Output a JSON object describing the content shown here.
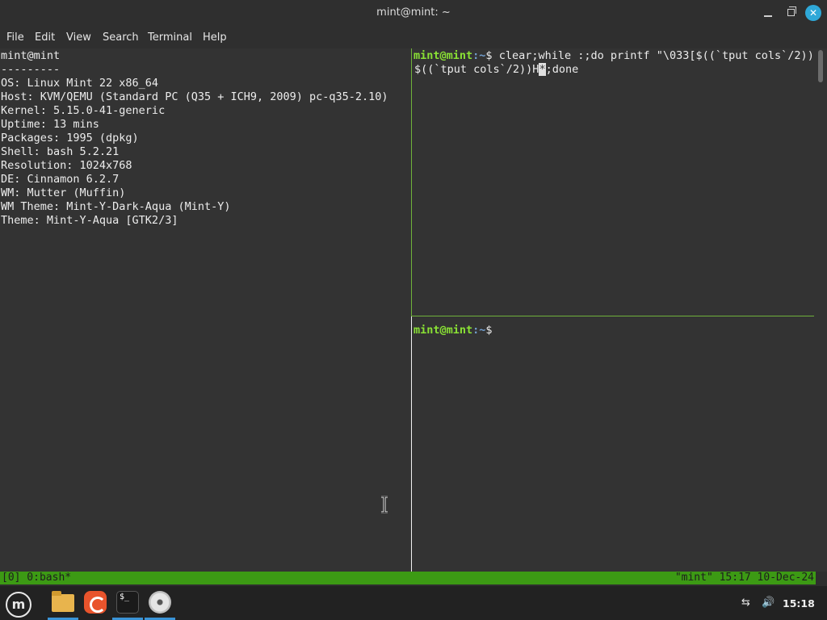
{
  "window": {
    "title": "mint@mint: ~",
    "minimize_icon": "minimize-icon",
    "maximize_icon": "maximize-icon",
    "close_icon": "close-icon",
    "close_glyph": "✕"
  },
  "menu": {
    "items": [
      "File",
      "Edit",
      "View",
      "Search",
      "Terminal",
      "Help"
    ]
  },
  "left_pane": {
    "lines": [
      "mint@mint",
      "---------",
      "OS: Linux Mint 22 x86_64",
      "Host: KVM/QEMU (Standard PC (Q35 + ICH9, 2009) pc-q35-2.10)",
      "Kernel: 5.15.0-41-generic",
      "Uptime: 13 mins",
      "Packages: 1995 (dpkg)",
      "Shell: bash 5.2.21",
      "Resolution: 1024x768",
      "DE: Cinnamon 6.2.7",
      "WM: Mutter (Muffin)",
      "WM Theme: Mint-Y-Dark-Aqua (Mint-Y)",
      "Theme: Mint-Y-Aqua [GTK2/3]"
    ]
  },
  "right_top_pane": {
    "prompt_user": "mint@mint",
    "prompt_path": ":~",
    "prompt_sign": "$ ",
    "command_line1": "clear;while :;do printf \"\\033[$((`tput cols`/2));",
    "command_line2_pre": "$((`tput cols`/2))H",
    "command_line2_cursor": "*",
    "command_line2_post": ";done"
  },
  "right_bottom_pane": {
    "prompt_user": "mint@mint",
    "prompt_path": ":~",
    "prompt_sign": "$"
  },
  "tmux_status": {
    "left": "[0] 0:bash*",
    "right": "\"mint\" 15:17 10-Dec-24"
  },
  "taskbar": {
    "menu_logo_text": "m",
    "apps": [
      {
        "name": "files",
        "icon": "folder-icon",
        "active": true
      },
      {
        "name": "firefox",
        "icon": "firefox-icon",
        "active": false
      },
      {
        "name": "terminal",
        "icon": "terminal-icon",
        "active": true
      },
      {
        "name": "disc",
        "icon": "disc-icon",
        "active": true
      }
    ],
    "terminal_icon_text": "$_",
    "network_icon": "network-disconnected-icon",
    "volume_icon": "volume-icon",
    "network_glyph": "⇆",
    "volume_glyph": "🔊",
    "clock": "15:18"
  },
  "colors": {
    "prompt_user": "#8ae234",
    "prompt_path": "#729fcf",
    "pane_divider": "#6fb13a",
    "tmux_status_bg": "#3c9a14",
    "accent": "#2fa8d8"
  }
}
